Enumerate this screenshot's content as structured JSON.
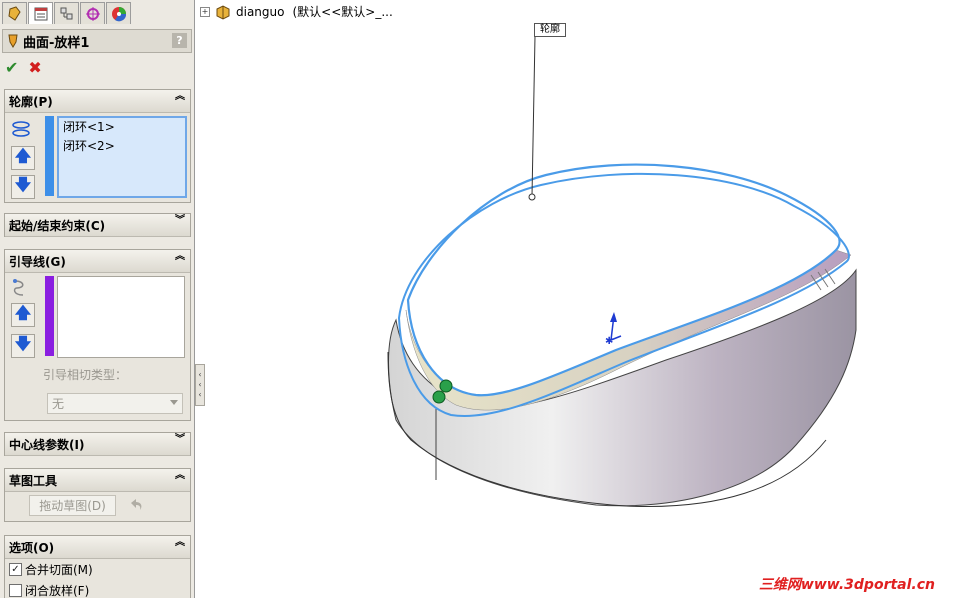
{
  "tabs": [
    "feature-manager-icon",
    "property-manager-icon",
    "configuration-manager-icon",
    "dimxpert-icon",
    "display-manager-icon"
  ],
  "feature": {
    "title": "曲面-放样1",
    "help": "?"
  },
  "actions": {
    "ok": "✔",
    "cancel": "✖"
  },
  "profiles": {
    "header": "轮廓(P)",
    "items": [
      "闭环<1>",
      "闭环<2>"
    ]
  },
  "start_end": {
    "header": "起始/结束约束(C)"
  },
  "guides": {
    "header": "引导线(G)",
    "tangency_label": "引导相切类型：",
    "tangency_value": "无"
  },
  "centerline": {
    "header": "中心线参数(I)"
  },
  "sketch_tools": {
    "header": "草图工具",
    "drag_button": "拖动草图(D)"
  },
  "options": {
    "header": "选项(O)",
    "merge_faces": "合并切面(M)",
    "merge_checked": true,
    "close_loft": "闭合放样(F)"
  },
  "tree": {
    "part": "dianguo",
    "config": "(默认<<默认>_..."
  },
  "viewport": {
    "callout": "轮廓"
  },
  "watermark": "三维网www.3dportal.cn"
}
